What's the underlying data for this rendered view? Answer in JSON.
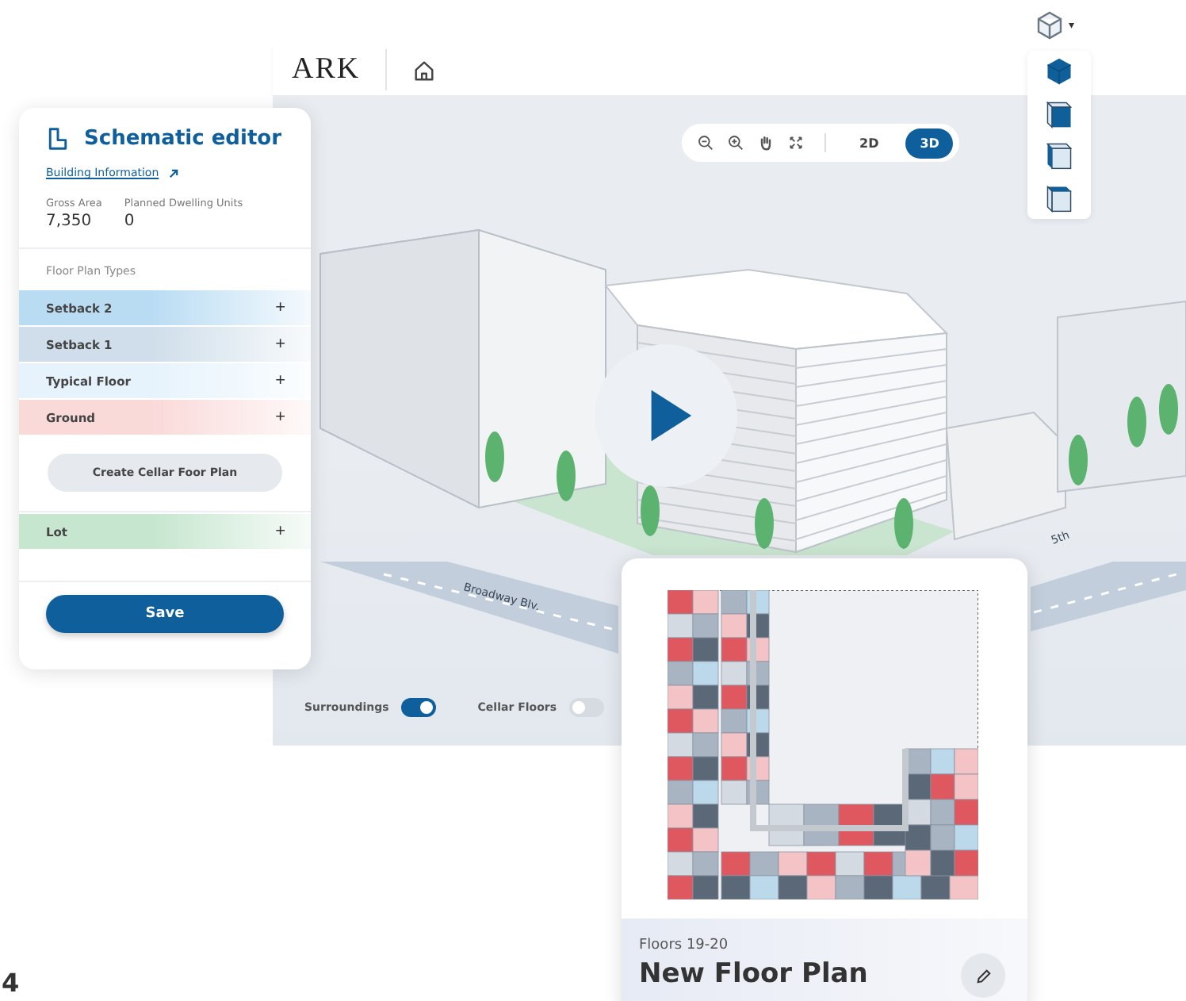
{
  "app": {
    "logo": "ARK"
  },
  "view_selector": {
    "caret": "▾",
    "options": [
      {
        "kind": "solid"
      },
      {
        "kind": "front"
      },
      {
        "kind": "side"
      },
      {
        "kind": "top"
      }
    ]
  },
  "view_toolbar": {
    "modes": [
      {
        "label": "2D",
        "selected": false
      },
      {
        "label": "3D",
        "selected": true
      }
    ]
  },
  "scene": {
    "streets": [
      {
        "label": "Broadway Blv."
      },
      {
        "label": "5th"
      }
    ]
  },
  "toggles": [
    {
      "label": "Surroundings",
      "on": true
    },
    {
      "label": "Cellar Floors",
      "on": false
    }
  ],
  "editor": {
    "title": "Schematic editor",
    "link": "Building Information",
    "stats": [
      {
        "label": "Gross Area",
        "value": "7,350"
      },
      {
        "label": "Planned Dwelling Units",
        "value": "0"
      }
    ],
    "section_label": "Floor Plan Types",
    "floor_types": [
      {
        "name": "Setback 2",
        "color": "#b9dcf3"
      },
      {
        "name": "Setback 1",
        "color": "#cfdeea"
      },
      {
        "name": "Typical Floor",
        "color": "#e6f3fc"
      },
      {
        "name": "Ground",
        "color": "#fad9d9"
      }
    ],
    "add_sign": "+",
    "cellar_button": "Create Cellar Foor Plan",
    "lot": {
      "name": "Lot",
      "color": "#c6e6cf"
    },
    "save": "Save"
  },
  "floor_plan": {
    "floors": "Floors 19-20",
    "name": "New Floor Plan"
  },
  "page_number": "4"
}
